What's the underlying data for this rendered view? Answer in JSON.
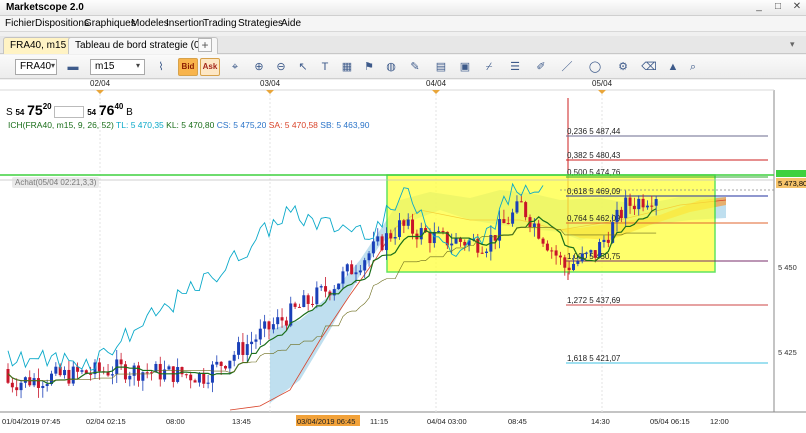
{
  "window": {
    "title": "Marketscope 2.0",
    "minimize": "_",
    "maximize": "□",
    "close": "✕"
  },
  "menu": [
    "Fichier",
    "Dispositions",
    "Graphiques",
    "Modeles",
    "Insertion",
    "Trading",
    "Strategies",
    "Aide"
  ],
  "tabs": [
    {
      "label": "FRA40, m15",
      "close": "×",
      "active": true
    },
    {
      "label": "Tableau de bord strategie (0/0)",
      "active": false
    }
  ],
  "tab_add": "+",
  "toolbar": {
    "instrument": "FRA40",
    "timeframe": "m15",
    "bid_label": "Bid",
    "ask_label": "Ask",
    "icons": [
      "chart-type-icon",
      "bid-icon",
      "ask-icon",
      "crosshair-icon",
      "zoom-in-icon",
      "zoom-out-icon",
      "arrow-icon",
      "text-icon",
      "indicator-icon",
      "globe-icon",
      "ruler-icon",
      "calendar-icon",
      "trade-icon",
      "trend-icon",
      "line-style-icon",
      "pen-icon",
      "color-icon",
      "shape-icon",
      "eraser-icon",
      "properties-icon",
      "lock-icon",
      "search-icon"
    ]
  },
  "quote": {
    "sell_label": "S",
    "sell_prefix": "54",
    "sell_big": "75",
    "sell_sup": "20",
    "buy_prefix": "54",
    "buy_big": "76",
    "buy_sup": "40",
    "buy_label": "B"
  },
  "indicator_line": {
    "name": "ICH(FRA40, m15, 9, 26, 52)",
    "tl": "TL: 5 470,35",
    "kl": "KL: 5 470,80",
    "cs": "CS: 5 475,20",
    "sa": "SA: 5 470,58",
    "sb": "SB: 5 463,90"
  },
  "achat_label": "Achat(05/04 02:21,3,3)",
  "date_labels_top": [
    "02/04",
    "03/04",
    "04/04",
    "05/04"
  ],
  "fibonacci_levels": [
    {
      "label": "0,236 5 487,44",
      "color": "#6b6b8f"
    },
    {
      "label": "0,382 5 480,43",
      "color": "#cc1f1f"
    },
    {
      "label": "0,500 5 474,76",
      "color": "#2da82d"
    },
    {
      "label": "0,618 5 469,09",
      "color": "#1f2f9f"
    },
    {
      "label": "0,764 5 462,09",
      "color": "#e0642e"
    },
    {
      "label": "1,000 5 450,75",
      "color": "#7a2c6b"
    },
    {
      "label": "1,272 5 437,69",
      "color": "#cc4444"
    },
    {
      "label": "1,618 5 421,07",
      "color": "#3fc0e0"
    }
  ],
  "price_labels": [
    "5 473,80",
    "5 450",
    "5 425"
  ],
  "x_axis_labels": [
    "01/04/2019 07:45",
    "02/04 02:15",
    "08:00",
    "13:45",
    "03/04/2019 06:45",
    "11:15",
    "04/04 03:00",
    "08:45",
    "14:30",
    "05/04 06:15",
    "12:00"
  ],
  "colors": {
    "bullish": "#1a40b8",
    "bearish": "#c8152a",
    "tenkan": "#0aa9c9",
    "kijun": "#1a6e1a",
    "cloud": "#a9d4ea",
    "cloud_red": "#f0a44d",
    "highlight": "#ffff3c",
    "highlight_border": "#2ddb2d"
  }
}
